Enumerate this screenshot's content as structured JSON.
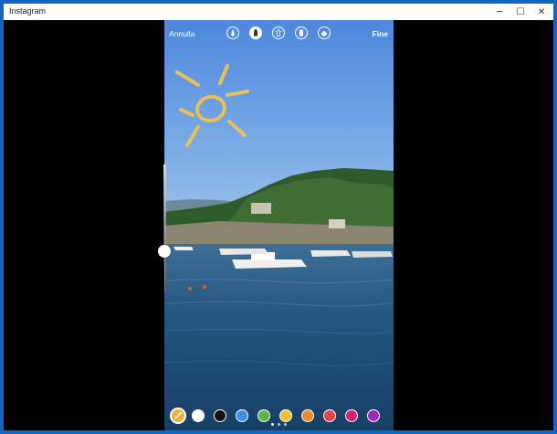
{
  "window": {
    "title": "Instagram",
    "minimize_glyph": "─",
    "maximize_glyph": "☐",
    "close_glyph": "✕"
  },
  "editor": {
    "cancel_label": "Annulla",
    "done_label": "Fine",
    "tools": [
      {
        "icon": "pen-marker-icon",
        "active": false
      },
      {
        "icon": "marker-icon",
        "active": true
      },
      {
        "icon": "neon-highlighter-icon",
        "active": false
      },
      {
        "icon": "chisel-marker-icon",
        "active": false
      },
      {
        "icon": "eraser-icon",
        "active": false
      }
    ],
    "brush_size_level": 0.63,
    "palette": [
      {
        "name": "eyedropper",
        "color": "#e6b23a",
        "selected": true
      },
      {
        "name": "white",
        "color": "#ffffff"
      },
      {
        "name": "black",
        "color": "#111111"
      },
      {
        "name": "blue",
        "color": "#3c8ee8"
      },
      {
        "name": "green",
        "color": "#5cb547"
      },
      {
        "name": "yellow",
        "color": "#f2c13b"
      },
      {
        "name": "orange",
        "color": "#f08a2b"
      },
      {
        "name": "red",
        "color": "#e8424c"
      },
      {
        "name": "magenta",
        "color": "#d5207c"
      },
      {
        "name": "purple",
        "color": "#a326b7"
      }
    ],
    "page_dots": 3,
    "active_page": 1,
    "drawing_color": "#e9c15a"
  }
}
